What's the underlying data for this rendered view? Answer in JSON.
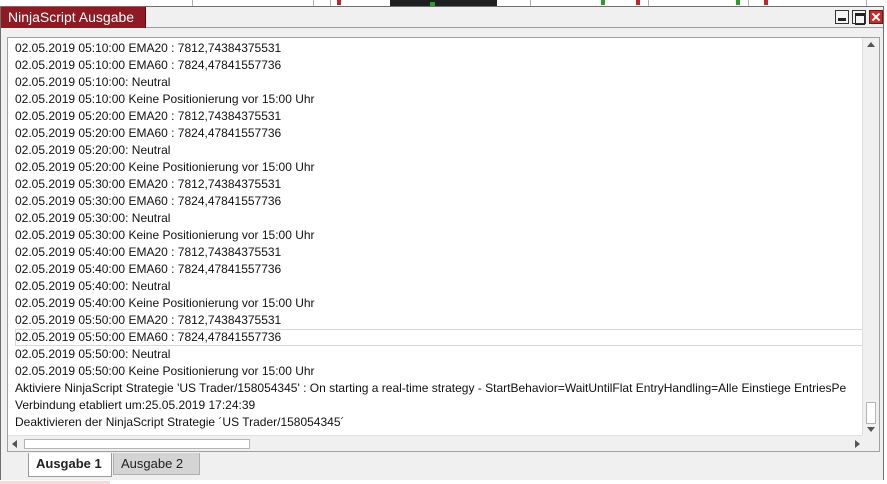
{
  "window": {
    "title": "NinjaScript Ausgabe"
  },
  "output": {
    "current_line_index": 17,
    "lines": [
      "02.05.2019 05:10:00 EMA20 : 7812,74384375531",
      "02.05.2019 05:10:00 EMA60 : 7824,47841557736",
      "02.05.2019 05:10:00: Neutral",
      "02.05.2019 05:10:00 Keine Positionierung vor 15:00 Uhr",
      "02.05.2019 05:20:00 EMA20 : 7812,74384375531",
      "02.05.2019 05:20:00 EMA60 : 7824,47841557736",
      "02.05.2019 05:20:00: Neutral",
      "02.05.2019 05:20:00 Keine Positionierung vor 15:00 Uhr",
      "02.05.2019 05:30:00 EMA20 : 7812,74384375531",
      "02.05.2019 05:30:00 EMA60 : 7824,47841557736",
      "02.05.2019 05:30:00: Neutral",
      "02.05.2019 05:30:00 Keine Positionierung vor 15:00 Uhr",
      "02.05.2019 05:40:00 EMA20 : 7812,74384375531",
      "02.05.2019 05:40:00 EMA60 : 7824,47841557736",
      "02.05.2019 05:40:00: Neutral",
      "02.05.2019 05:40:00 Keine Positionierung vor 15:00 Uhr",
      "02.05.2019 05:50:00 EMA20 : 7812,74384375531",
      "02.05.2019 05:50:00 EMA60 : 7824,47841557736",
      "02.05.2019 05:50:00: Neutral",
      "02.05.2019 05:50:00 Keine Positionierung vor 15:00 Uhr",
      "Aktiviere NinjaScript Strategie 'US Trader/158054345' : On starting a real-time strategy - StartBehavior=WaitUntilFlat EntryHandling=Alle Einstiege EntriesPe",
      "Verbindung etabliert um:25.05.2019 17:24:39",
      "Deaktivieren der NinjaScript Strategie ´US Trader/158054345´"
    ]
  },
  "tabs": [
    {
      "label": "Ausgabe 1",
      "active": true
    },
    {
      "label": "Ausgabe 2",
      "active": false
    }
  ],
  "colors": {
    "title_tab": "#8f1a24",
    "close_button": "#c42b2b"
  }
}
